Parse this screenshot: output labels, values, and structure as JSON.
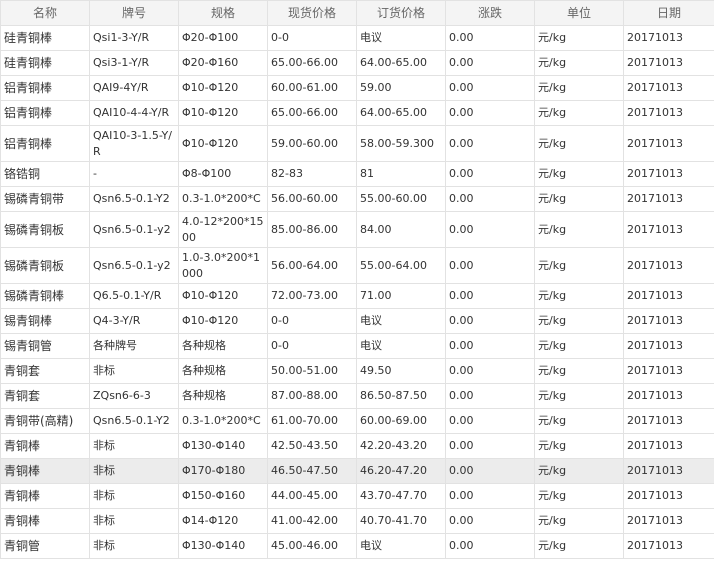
{
  "headers": [
    "名称",
    "牌号",
    "规格",
    "现货价格",
    "订货价格",
    "涨跌",
    "单位",
    "日期"
  ],
  "rows": [
    [
      "硅青铜棒",
      "Qsi1-3-Y/R",
      "Φ20-Φ100",
      "0-0",
      "电议",
      "0.00",
      "元/kg",
      "20171013"
    ],
    [
      "硅青铜棒",
      "Qsi3-1-Y/R",
      "Φ20-Φ160",
      "65.00-66.00",
      "64.00-65.00",
      "0.00",
      "元/kg",
      "20171013"
    ],
    [
      "铝青铜棒",
      "QAI9-4Y/R",
      "Φ10-Φ120",
      "60.00-61.00",
      "59.00",
      "0.00",
      "元/kg",
      "20171013"
    ],
    [
      "铝青铜棒",
      "QAI10-4-4-Y/R",
      "Φ10-Φ120",
      "65.00-66.00",
      "64.00-65.00",
      "0.00",
      "元/kg",
      "20171013"
    ],
    [
      "铝青铜棒",
      "QAI10-3-1.5-Y/R",
      "Φ10-Φ120",
      "59.00-60.00",
      "58.00-59.300",
      "0.00",
      "元/kg",
      "20171013"
    ],
    [
      "铬锆铜",
      "-",
      "Φ8-Φ100",
      "82-83",
      "81",
      "0.00",
      "元/kg",
      "20171013"
    ],
    [
      "锡磷青铜带",
      "Qsn6.5-0.1-Y2",
      "0.3-1.0*200*C",
      "56.00-60.00",
      "55.00-60.00",
      "0.00",
      "元/kg",
      "20171013"
    ],
    [
      "锡磷青铜板",
      "Qsn6.5-0.1-y2",
      "4.0-12*200*1500",
      "85.00-86.00",
      "84.00",
      "0.00",
      "元/kg",
      "20171013"
    ],
    [
      "锡磷青铜板",
      "Qsn6.5-0.1-y2",
      "1.0-3.0*200*1000",
      "56.00-64.00",
      "55.00-64.00",
      "0.00",
      "元/kg",
      "20171013"
    ],
    [
      "锡磷青铜棒",
      "Q6.5-0.1-Y/R",
      "Φ10-Φ120",
      "72.00-73.00",
      "71.00",
      "0.00",
      "元/kg",
      "20171013"
    ],
    [
      "锡青铜棒",
      "Q4-3-Y/R",
      "Φ10-Φ120",
      "0-0",
      "电议",
      "0.00",
      "元/kg",
      "20171013"
    ],
    [
      "锡青铜管",
      "各种牌号",
      "各种规格",
      "0-0",
      "电议",
      "0.00",
      "元/kg",
      "20171013"
    ],
    [
      "青铜套",
      "非标",
      "各种规格",
      "50.00-51.00",
      "49.50",
      "0.00",
      "元/kg",
      "20171013"
    ],
    [
      "青铜套",
      "ZQsn6-6-3",
      "各种规格",
      "87.00-88.00",
      "86.50-87.50",
      "0.00",
      "元/kg",
      "20171013"
    ],
    [
      "青铜带(高精)",
      "Qsn6.5-0.1-Y2",
      "0.3-1.0*200*C",
      "61.00-70.00",
      "60.00-69.00",
      "0.00",
      "元/kg",
      "20171013"
    ],
    [
      "青铜棒",
      "非标",
      "Φ130-Φ140",
      "42.50-43.50",
      "42.20-43.20",
      "0.00",
      "元/kg",
      "20171013"
    ],
    [
      "青铜棒",
      "非标",
      "Φ170-Φ180",
      "46.50-47.50",
      "46.20-47.20",
      "0.00",
      "元/kg",
      "20171013"
    ],
    [
      "青铜棒",
      "非标",
      "Φ150-Φ160",
      "44.00-45.00",
      "43.70-47.70",
      "0.00",
      "元/kg",
      "20171013"
    ],
    [
      "青铜棒",
      "非标",
      "Φ14-Φ120",
      "41.00-42.00",
      "40.70-41.70",
      "0.00",
      "元/kg",
      "20171013"
    ],
    [
      "青铜管",
      "非标",
      "Φ130-Φ140",
      "45.00-46.00",
      "电议",
      "0.00",
      "元/kg",
      "20171013"
    ]
  ]
}
